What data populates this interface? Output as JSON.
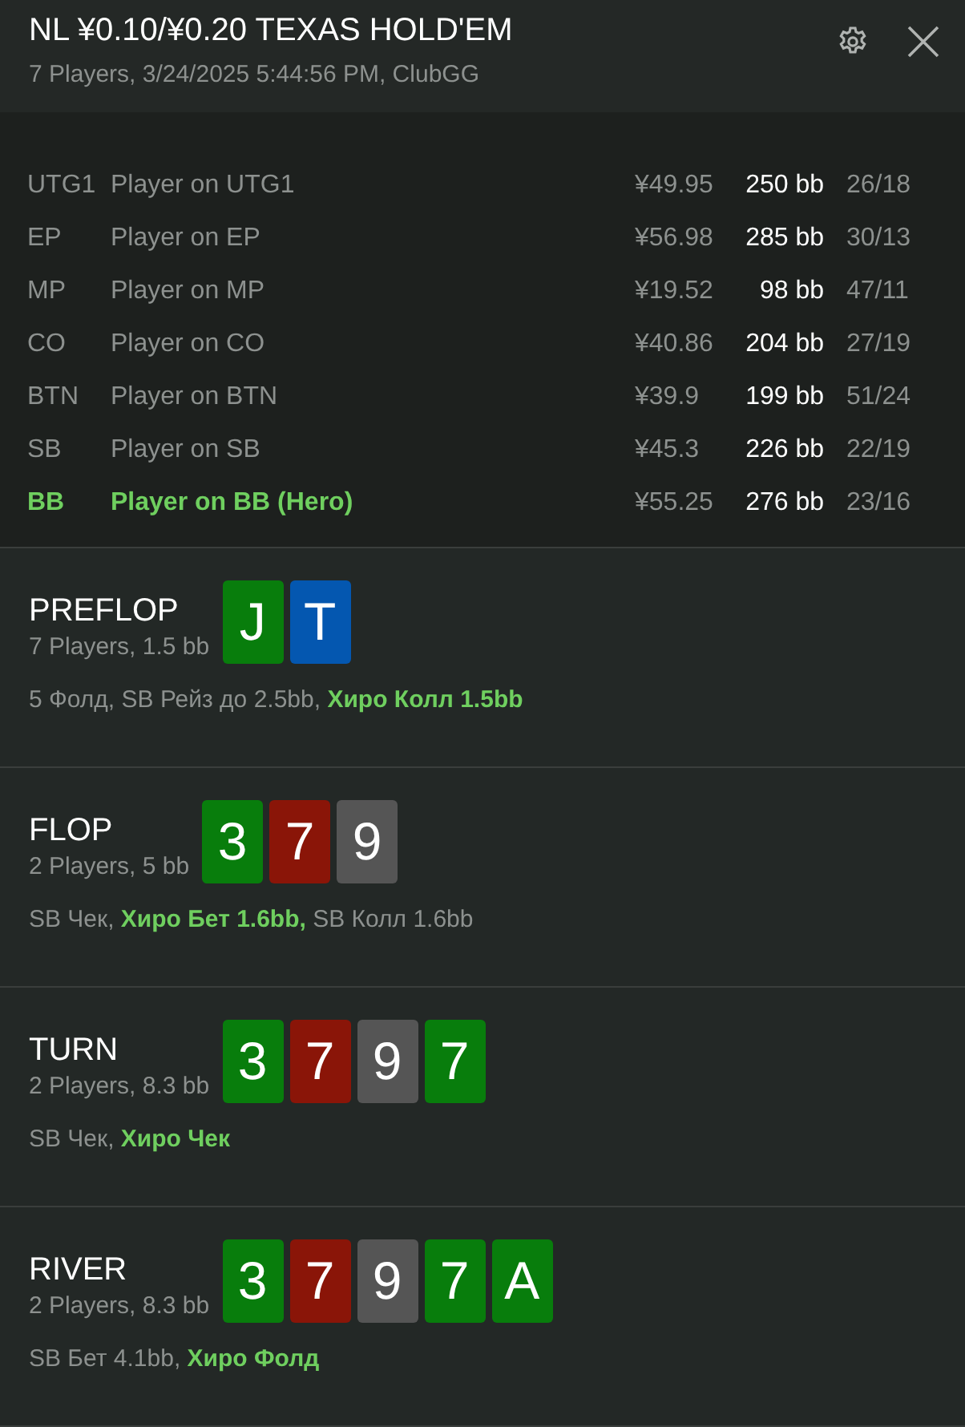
{
  "header": {
    "title": "NL ¥0.10/¥0.20 TEXAS HOLD'EM",
    "subtitle": "7 Players, 3/24/2025 5:44:56 PM, ClubGG"
  },
  "players": [
    {
      "position": "UTG1",
      "name": "Player on UTG1",
      "stack": "¥49.95",
      "bb": "250 bb",
      "stats": "26/18",
      "hero": false
    },
    {
      "position": "EP",
      "name": "Player on EP",
      "stack": "¥56.98",
      "bb": "285 bb",
      "stats": "30/13",
      "hero": false
    },
    {
      "position": "MP",
      "name": "Player on MP",
      "stack": "¥19.52",
      "bb": "98 bb",
      "stats": "47/11",
      "hero": false
    },
    {
      "position": "CO",
      "name": "Player on CO",
      "stack": "¥40.86",
      "bb": "204 bb",
      "stats": "27/19",
      "hero": false
    },
    {
      "position": "BTN",
      "name": "Player on BTN",
      "stack": "¥39.9",
      "bb": "199 bb",
      "stats": "51/24",
      "hero": false
    },
    {
      "position": "SB",
      "name": "Player on SB",
      "stack": "¥45.3",
      "bb": "226 bb",
      "stats": "22/19",
      "hero": false
    },
    {
      "position": "BB",
      "name": "Player on BB (Hero)",
      "stack": "¥55.25",
      "bb": "276 bb",
      "stats": "23/16",
      "hero": true
    }
  ],
  "streets": [
    {
      "name": "PREFLOP",
      "info": "7 Players, 1.5 bb",
      "cards": [
        {
          "rank": "J",
          "color": "#087d0c"
        },
        {
          "rank": "T",
          "color": "#0457b0"
        }
      ],
      "actions": [
        {
          "text": "5 Фолд, SB Рейз до 2.5bb, ",
          "hero": false
        },
        {
          "text": "Хиро Колл 1.5bb",
          "hero": true
        }
      ]
    },
    {
      "name": "FLOP",
      "info": "2 Players, 5 bb",
      "cards": [
        {
          "rank": "3",
          "color": "#087d0c"
        },
        {
          "rank": "7",
          "color": "#8a1508"
        },
        {
          "rank": "9",
          "color": "#555555"
        }
      ],
      "actions": [
        {
          "text": "SB Чек, ",
          "hero": false
        },
        {
          "text": "Хиро Бет 1.6bb,",
          "hero": true
        },
        {
          "text": " SB Колл 1.6bb",
          "hero": false
        }
      ]
    },
    {
      "name": "TURN",
      "info": "2 Players, 8.3 bb",
      "cards": [
        {
          "rank": "3",
          "color": "#087d0c"
        },
        {
          "rank": "7",
          "color": "#8a1508"
        },
        {
          "rank": "9",
          "color": "#555555"
        },
        {
          "rank": "7",
          "color": "#087d0c"
        }
      ],
      "actions": [
        {
          "text": "SB Чек, ",
          "hero": false
        },
        {
          "text": "Хиро Чек",
          "hero": true
        }
      ]
    },
    {
      "name": "RIVER",
      "info": "2 Players, 8.3 bb",
      "cards": [
        {
          "rank": "3",
          "color": "#087d0c"
        },
        {
          "rank": "7",
          "color": "#8a1508"
        },
        {
          "rank": "9",
          "color": "#555555"
        },
        {
          "rank": "7",
          "color": "#087d0c"
        },
        {
          "rank": "A",
          "color": "#087d0c"
        }
      ],
      "actions": [
        {
          "text": "SB Бет 4.1bb, ",
          "hero": false
        },
        {
          "text": "Хиро Фолд",
          "hero": true
        }
      ]
    }
  ]
}
